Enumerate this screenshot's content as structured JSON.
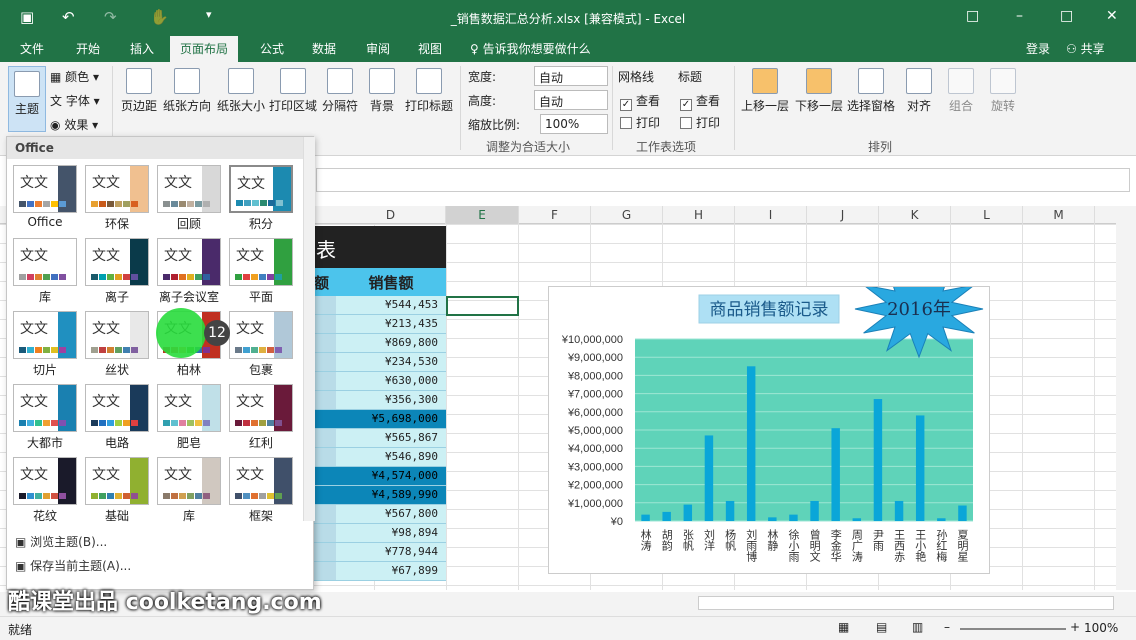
{
  "window": {
    "title": "_销售数据汇总分析.xlsx  [兼容模式] - Excel",
    "controls": [
      "□",
      "–",
      "□",
      "✕"
    ]
  },
  "tabs": [
    "文件",
    "开始",
    "插入",
    "页面布局",
    "公式",
    "数据",
    "审阅",
    "视图"
  ],
  "tell_me": "告诉我你想要做什么",
  "account": {
    "login": "登录",
    "share": "共享"
  },
  "ribbon": {
    "theme": "主题",
    "colors": "颜色",
    "fonts": "字体",
    "effects": "效果",
    "margins": "页边距",
    "orientation": "纸张方向",
    "size": "纸张大小",
    "print_area": "打印区域",
    "breaks": "分隔符",
    "background": "背景",
    "print_titles": "打印标题",
    "width_label": "宽度:",
    "height_label": "高度:",
    "scale_label": "缩放比例:",
    "width_val": "自动",
    "height_val": "自动",
    "scale_val": "100%",
    "group_scale": "调整为合适大小",
    "gridlines": "网格线",
    "headings": "标题",
    "view": "查看",
    "print": "打印",
    "group_sheet": "工作表选项",
    "bring_forward": "上移一层",
    "send_backward": "下移一层",
    "selection_pane": "选择窗格",
    "align": "对齐",
    "group": "组合",
    "rotate": "旋转",
    "group_arrange": "排列"
  },
  "columns": [
    "D",
    "E",
    "F",
    "G",
    "H",
    "I",
    "J",
    "K",
    "L",
    "M"
  ],
  "sheet": {
    "title": "表",
    "col_b_header": "额",
    "col_d_header": "销售额",
    "values": [
      "¥544,453",
      "¥213,435",
      "¥869,800",
      "¥234,530",
      "¥630,000",
      "¥356,300",
      "¥5,698,000",
      "¥565,867",
      "¥546,890",
      "¥4,574,000",
      "¥4,589,990",
      "¥567,800",
      "¥98,894",
      "¥778,944",
      "¥67,899"
    ]
  },
  "theme_panel": {
    "header": "Office",
    "themes": [
      "Office",
      "环保",
      "回顾",
      "积分",
      "库",
      "离子",
      "离子会议室",
      "平面",
      "切片",
      "丝状",
      "柏林",
      "包裹",
      "大都市",
      "电路",
      "肥皂",
      "红利",
      "花纹",
      "基础",
      "库",
      "框架"
    ],
    "browse": "浏览主题(B)...",
    "save": "保存当前主题(A)..."
  },
  "badge": "12",
  "watermark": "酷课堂出品 coolketang.com",
  "status": {
    "ready": "就绪",
    "zoom": "100%"
  },
  "chart_data": {
    "type": "bar",
    "title": "商品销售额记录",
    "badge": "2016年",
    "categories": [
      "林涛",
      "胡韵",
      "张帆",
      "刘洋",
      "杨帆",
      "刘雨博",
      "林静",
      "徐小雨",
      "曾明文",
      "李金华",
      "周广涛",
      "尹雨",
      "王西赤",
      "王小艳",
      "孙红梅",
      "夏明星"
    ],
    "values": [
      350000,
      500000,
      900000,
      4700000,
      1100000,
      8500000,
      200000,
      350000,
      1100000,
      5100000,
      150000,
      6700000,
      1100000,
      5800000,
      150000,
      850000
    ],
    "yticks": [
      "¥0",
      "¥1,000,000",
      "¥2,000,000",
      "¥3,000,000",
      "¥4,000,000",
      "¥5,000,000",
      "¥6,000,000",
      "¥7,000,000",
      "¥8,000,000",
      "¥9,000,000",
      "¥10,000,000"
    ],
    "ylim": [
      0,
      10000000
    ],
    "grid": true,
    "bar_color": "#0aa6d8",
    "plot_bg": "#5fd3b9"
  }
}
